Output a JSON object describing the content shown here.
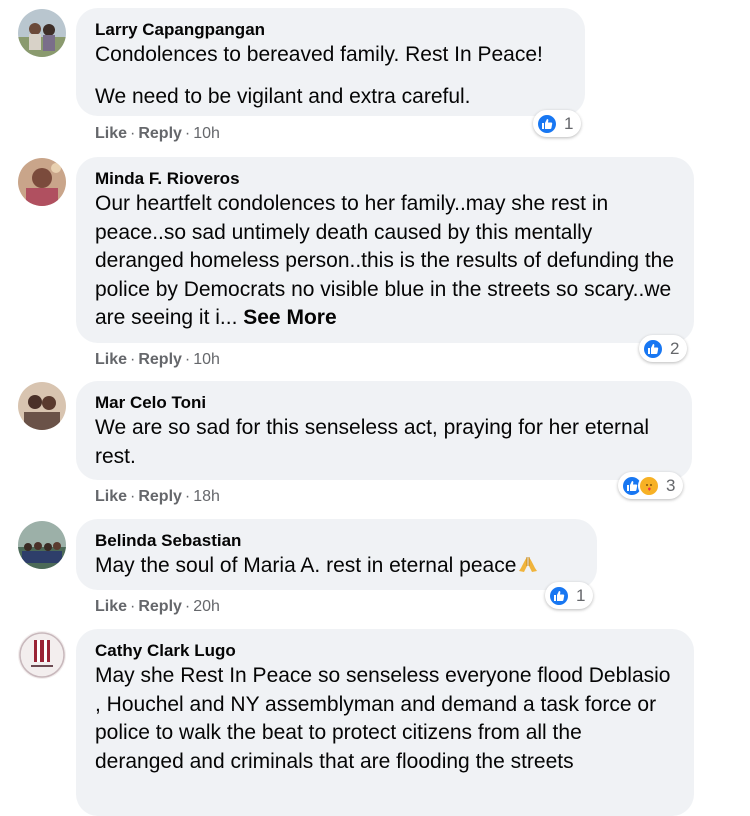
{
  "actions": {
    "like": "Like",
    "reply": "Reply",
    "separator": "·"
  },
  "comments": [
    {
      "author": "Larry Capangpangan",
      "paragraphs": [
        "Condolences to bereaved family. Rest In Peace!",
        "We need to be vigilant and extra careful."
      ],
      "time": "10h",
      "reaction_count": "1",
      "reactions": [
        "like"
      ]
    },
    {
      "author": "Minda F. Rioveros",
      "text": "Our heartfelt condolences to her family..may she rest in peace..so sad untimely death caused by this mentally deranged homeless person..this is the results of defunding the police by Democrats no visible blue in the streets so scary..we are seeing it i...",
      "see_more": "See More",
      "time": "10h",
      "reaction_count": "2",
      "reactions": [
        "like"
      ]
    },
    {
      "author": "Mar Celo Toni",
      "text": "We are so sad for this senseless act, praying for her eternal rest.",
      "time": "18h",
      "reaction_count": "3",
      "reactions": [
        "like",
        "care"
      ]
    },
    {
      "author": "Belinda Sebastian",
      "text": "May the soul of Maria A. rest in eternal peace",
      "emoji": "folded-hands-emoji",
      "time": "20h",
      "reaction_count": "1",
      "reactions": [
        "like"
      ]
    },
    {
      "author": "Cathy Clark Lugo",
      "text": "May she Rest In Peace so senseless everyone flood Deblasio , Houchel and NY assemblyman and demand a task force or police to walk the beat to protect citizens from all the deranged and criminals that are flooding the streets"
    }
  ],
  "colors": {
    "bubble": "#f0f2f5",
    "meta_text": "#65676b",
    "like_blue": "#1877f2"
  }
}
